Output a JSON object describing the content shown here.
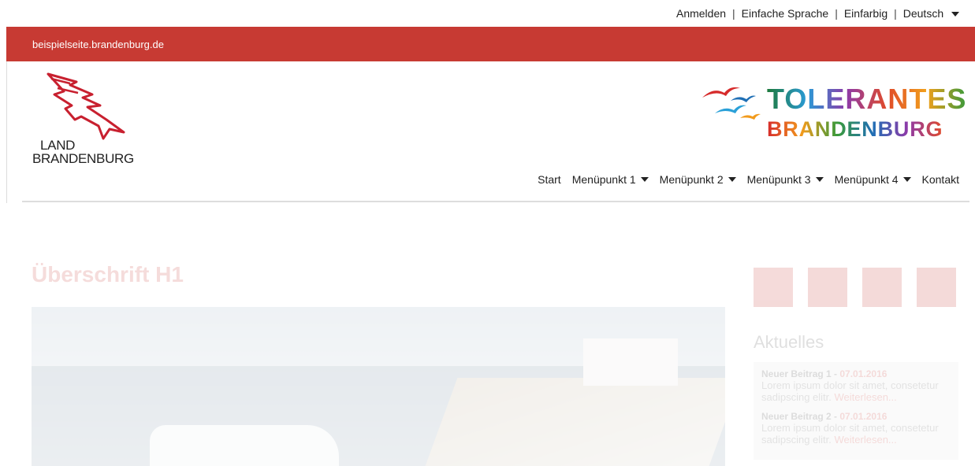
{
  "topbar": {
    "links": [
      "Anmelden",
      "Einfache Sprache",
      "Einfarbig",
      "Deutsch"
    ]
  },
  "site": {
    "url": "beispielseite.brandenburg.de"
  },
  "logo_left": {
    "line1": "LAND",
    "line2": "BRANDENBURG"
  },
  "logo_right": {
    "line1": "TOLERANTES",
    "line2": "BRANDENBURG"
  },
  "nav": {
    "items": [
      {
        "label": "Start",
        "dropdown": false
      },
      {
        "label": "Menüpunkt 1",
        "dropdown": true
      },
      {
        "label": "Menüpunkt 2",
        "dropdown": true
      },
      {
        "label": "Menüpunkt 3",
        "dropdown": true
      },
      {
        "label": "Menüpunkt 4",
        "dropdown": true
      },
      {
        "label": "Kontakt",
        "dropdown": false
      }
    ]
  },
  "main": {
    "title": "Überschrift H1"
  },
  "sidebar": {
    "social_icons": [
      "twitter-icon",
      "facebook-icon",
      "instagram-icon",
      "youtube-icon"
    ],
    "title": "Aktuelles",
    "news": [
      {
        "title": "Neuer Beitrag 1",
        "date": "07.01.2016",
        "text": "Lorem ipsum dolor sit amet, consetetur sadipscing elitr.",
        "more": "Weiterlesen..."
      },
      {
        "title": "Neuer Beitrag 2",
        "date": "07.01.2016",
        "text": "Lorem ipsum dolor sit amet, consetetur sadipscing elitr.",
        "more": "Weiterlesen..."
      }
    ]
  },
  "colors": {
    "brand_red": "#c73a33",
    "nav_text": "#222222"
  }
}
